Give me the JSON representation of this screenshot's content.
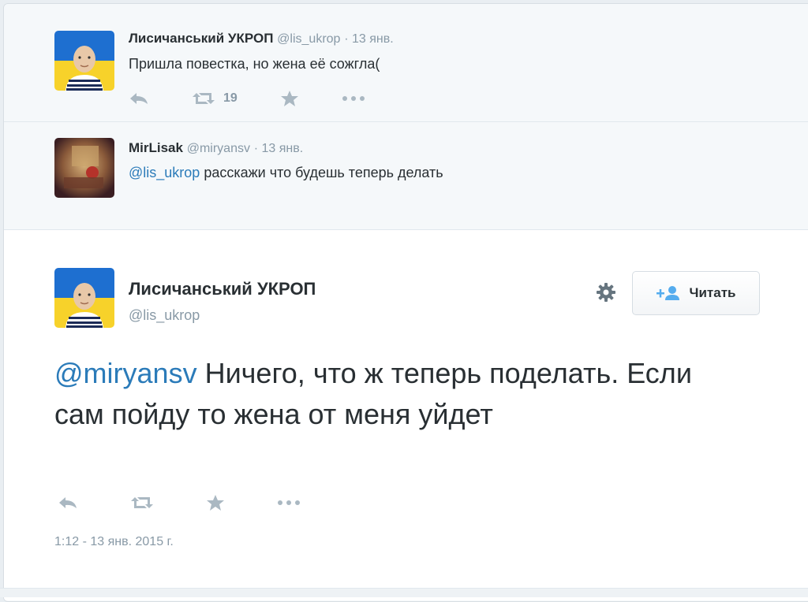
{
  "replies": [
    {
      "fullname": "Лисичанський УКРОП",
      "handle": "@lis_ukrop",
      "time": "· 13 янв.",
      "text": "Пришла повестка, но жена её сожгла(",
      "retweet_count": "19",
      "avatar_icon": "ukraine-flag-avatar-icon"
    },
    {
      "fullname": "MirLisak",
      "handle": "@miryansv",
      "time": "· 13 янв.",
      "mention": "@lis_ukrop",
      "text": " расскажи что будешь теперь делать",
      "avatar_icon": "photo-avatar-icon"
    }
  ],
  "main_tweet": {
    "fullname": "Лисичанський УКРОП",
    "handle": "@lis_ukrop",
    "follow_label": "Читать",
    "mention": "@miryansv",
    "text": " Ничего, что ж теперь поделать. Если сам пойду то жена от меня уйдет",
    "timestamp": "1:12 - 13 янв. 2015 г."
  },
  "colors": {
    "link": "#2b7bb9",
    "muted": "#8899a6",
    "icon": "#aab8c2",
    "flag_blue": "#1e6fd0",
    "flag_yellow": "#f7d22a"
  }
}
